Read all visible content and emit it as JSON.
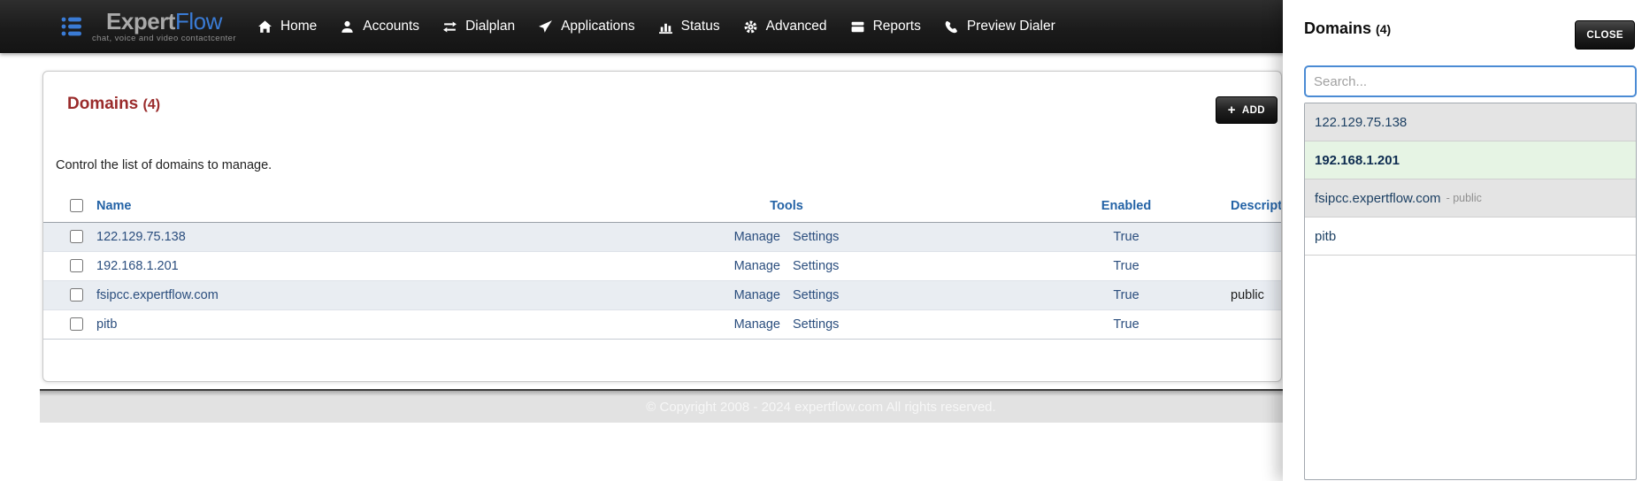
{
  "navbar": {
    "brand": {
      "expert": "Expert",
      "flow": "Flow",
      "tagline": "chat, voice and video contactcenter"
    },
    "items": [
      {
        "label": "Home",
        "icon": "home-icon"
      },
      {
        "label": "Accounts",
        "icon": "user-icon"
      },
      {
        "label": "Dialplan",
        "icon": "transfer-arrows-icon"
      },
      {
        "label": "Applications",
        "icon": "paper-plane-icon"
      },
      {
        "label": "Status",
        "icon": "bar-chart-icon"
      },
      {
        "label": "Advanced",
        "icon": "gear-icon"
      },
      {
        "label": "Reports",
        "icon": "archive-icon"
      },
      {
        "label": "Preview Dialer",
        "icon": "phone-icon"
      }
    ]
  },
  "page": {
    "title": "Domains",
    "count_label": "(4)",
    "subtitle": "Control the list of domains to manage.",
    "add_label": "ADD",
    "add_plus": "+"
  },
  "table": {
    "headers": {
      "name": "Name",
      "tools": "Tools",
      "enabled": "Enabled",
      "description": "Description"
    },
    "tools": {
      "manage": "Manage",
      "settings": "Settings"
    },
    "rows": [
      {
        "name": "122.129.75.138",
        "enabled": "True",
        "description": ""
      },
      {
        "name": "192.168.1.201",
        "enabled": "True",
        "description": ""
      },
      {
        "name": "fsipcc.expertflow.com",
        "enabled": "True",
        "description": "public"
      },
      {
        "name": "pitb",
        "enabled": "True",
        "description": ""
      }
    ]
  },
  "footer": {
    "copyright": "© Copyright 2008 - 2024 expertflow.com All rights reserved."
  },
  "panel": {
    "title": "Domains",
    "count_label": "(4)",
    "close_label": "CLOSE",
    "search_placeholder": "Search...",
    "search_value": "",
    "items": [
      {
        "label": "122.129.75.138",
        "suffix": ""
      },
      {
        "label": "192.168.1.201",
        "suffix": ""
      },
      {
        "label": "fsipcc.expertflow.com",
        "suffix": "- public"
      },
      {
        "label": "pitb",
        "suffix": ""
      }
    ]
  },
  "colors": {
    "navbar_bg": "#1b1b1b",
    "brand_blue": "#3a7bd5",
    "heading_maroon": "#9a2b2b",
    "table_header_blue": "#2463a6",
    "link_navy": "#2b4e7e",
    "visited_link": "#8e9fc9",
    "row_stripe_bg": "#e9edf2",
    "panel_item_gray_bg": "#e4e4e4",
    "panel_active_green_bg": "#e6f4e4",
    "search_focus_blue": "#4b8bd4",
    "footer_strip_bg": "#e2e2e2"
  }
}
